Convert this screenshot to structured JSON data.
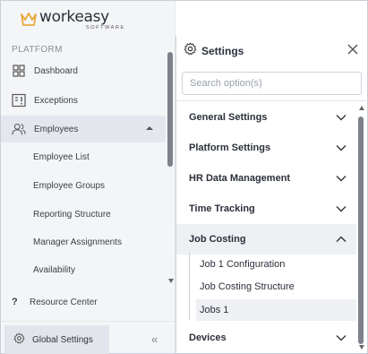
{
  "brand": {
    "name": "workeasy",
    "subtitle": "SOFTWARE",
    "accent": "#e8a83a"
  },
  "sidebar": {
    "section_label": "PLATFORM",
    "items": [
      {
        "label": "Dashboard",
        "icon": "dashboard-icon"
      },
      {
        "label": "Exceptions",
        "icon": "exceptions-icon"
      },
      {
        "label": "Employees",
        "icon": "users-icon",
        "expanded": true
      }
    ],
    "employee_subitems": [
      "Employee List",
      "Employee Groups",
      "Reporting Structure",
      "Manager Assignments",
      "Availability"
    ],
    "resource_center": {
      "label": "Resource Center",
      "icon": "question-icon"
    },
    "global_settings": {
      "label": "Global Settings",
      "icon": "gear-icon"
    },
    "collapse_label": "«"
  },
  "settings": {
    "title": "Settings",
    "search_placeholder": "Search option(s)",
    "sections": [
      {
        "label": "General Settings",
        "expanded": false
      },
      {
        "label": "Platform Settings",
        "expanded": false
      },
      {
        "label": "HR Data Management",
        "expanded": false
      },
      {
        "label": "Time Tracking",
        "expanded": false
      },
      {
        "label": "Job Costing",
        "expanded": true
      },
      {
        "label": "Devices",
        "expanded": false
      }
    ],
    "job_costing_children": [
      {
        "label": "Job 1 Configuration",
        "selected": false
      },
      {
        "label": "Job Costing Structure",
        "selected": false
      },
      {
        "label": "Jobs 1",
        "selected": true
      }
    ]
  }
}
